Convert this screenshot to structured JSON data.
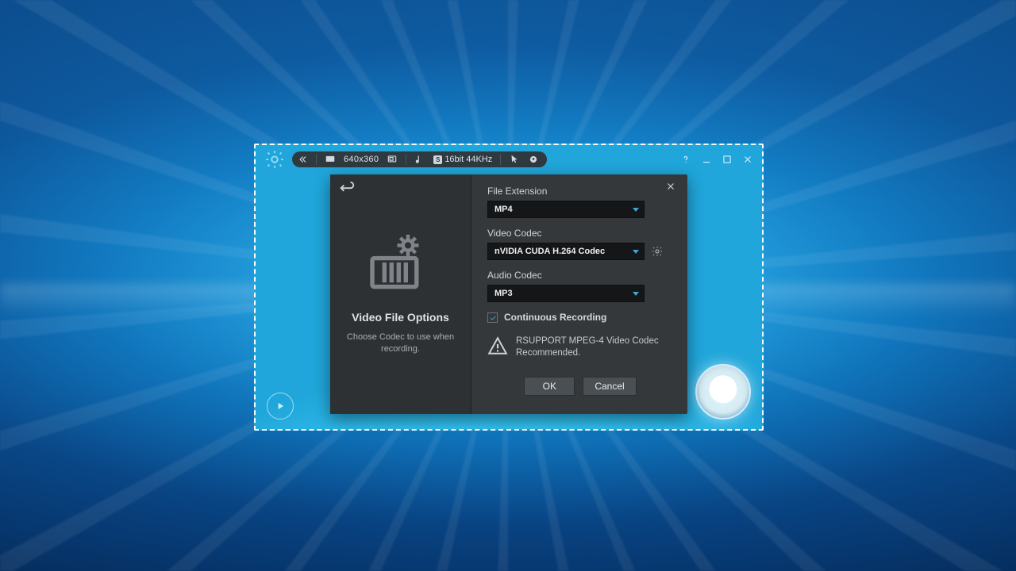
{
  "toolbar": {
    "resolution": "640x360",
    "audio_format": "16bit 44KHz"
  },
  "dialog": {
    "title": "Video File Options",
    "description": "Choose Codec to use when recording.",
    "fields": {
      "file_extension": {
        "label": "File Extension",
        "value": "MP4"
      },
      "video_codec": {
        "label": "Video Codec",
        "value": "nVIDIA CUDA H.264 Codec"
      },
      "audio_codec": {
        "label": "Audio Codec",
        "value": "MP3"
      }
    },
    "continuous_recording": {
      "label": "Continuous Recording",
      "checked": true
    },
    "warning": "RSUPPORT MPEG-4 Video Codec Recommended.",
    "buttons": {
      "ok": "OK",
      "cancel": "Cancel"
    }
  }
}
